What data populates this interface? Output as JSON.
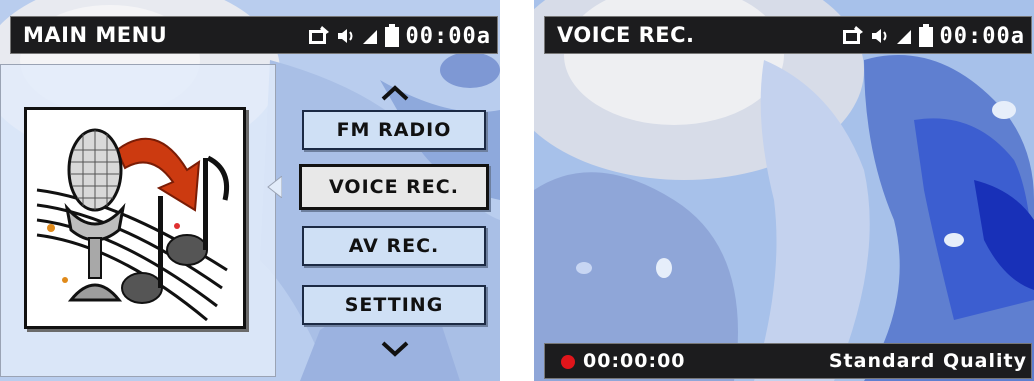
{
  "screens": {
    "main_menu": {
      "title": "MAIN MENU",
      "clock": "00:00a",
      "status_icons": [
        "media-card-icon",
        "speaker-volume-icon",
        "signal-icon",
        "battery-icon"
      ],
      "menu_items": [
        {
          "label": "FM RADIO",
          "selected": false
        },
        {
          "label": "VOICE REC.",
          "selected": true
        },
        {
          "label": "AV REC.",
          "selected": false
        },
        {
          "label": "SETTING",
          "selected": false
        }
      ],
      "preview_icon": "microphone-music-icon",
      "scroll_up_icon": "chevron-up-icon",
      "scroll_down_icon": "chevron-down-icon"
    },
    "voice_rec": {
      "title": "VOICE REC.",
      "clock": "00:00a",
      "status_icons": [
        "media-card-icon",
        "speaker-volume-icon",
        "signal-icon",
        "battery-icon"
      ],
      "recording_time": "00:00:00",
      "quality": "Standard Quality",
      "record_indicator_color": "#e0151b"
    }
  },
  "colors": {
    "bar_background": "#1c1c1e",
    "button_fill": "#cfe0f5",
    "selected_button_fill": "#e8e8e8"
  }
}
